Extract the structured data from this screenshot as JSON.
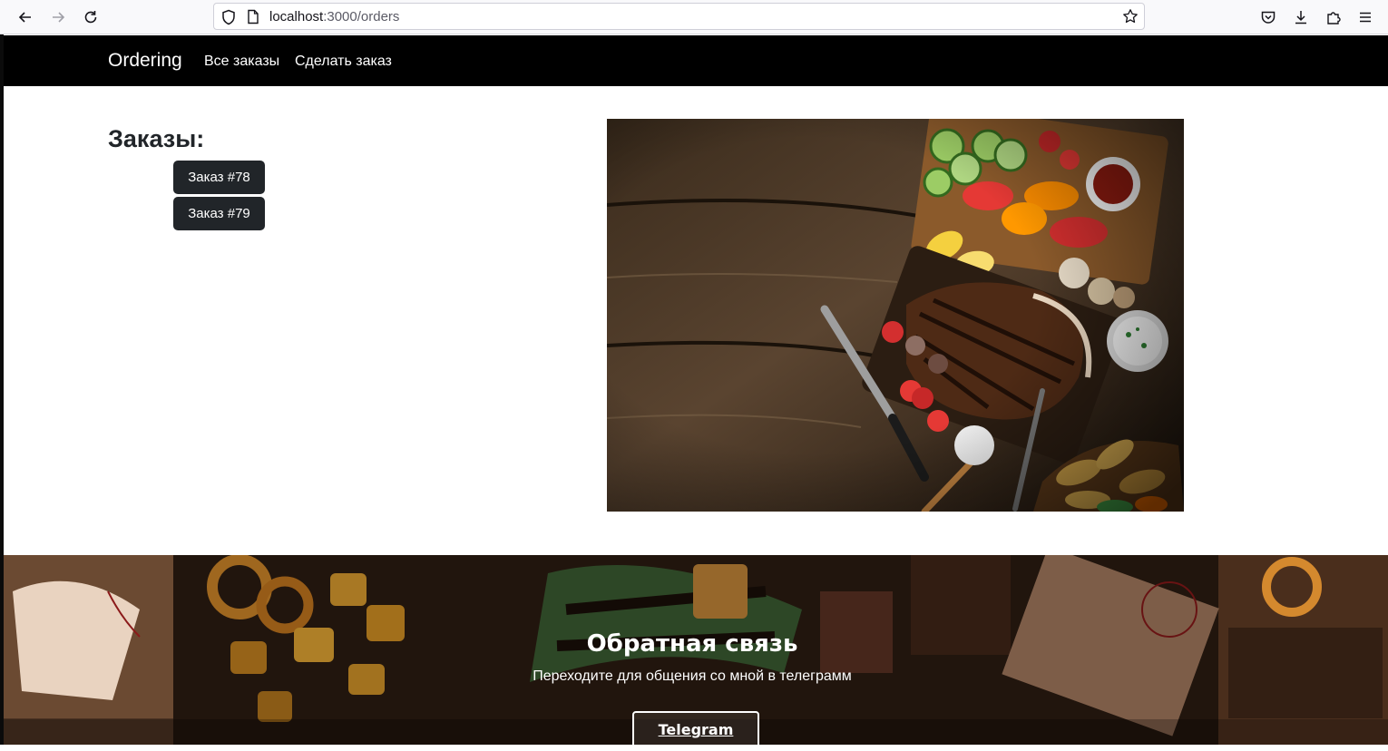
{
  "browser": {
    "url_host": "localhost",
    "url_rest": ":3000/orders"
  },
  "navbar": {
    "brand": "Ordering",
    "links": [
      "Все заказы",
      "Сделать заказ"
    ]
  },
  "orders": {
    "title": "Заказы:",
    "items": [
      "Заказ #78",
      "Заказ #79"
    ]
  },
  "footer": {
    "title": "Обратная связь",
    "subtitle": "Переходите для общения со мной в телеграмм",
    "button": "Telegram"
  },
  "colors": {
    "navbar_bg": "#000000",
    "button_dark": "#212529",
    "page_bg": "#ffffff"
  }
}
